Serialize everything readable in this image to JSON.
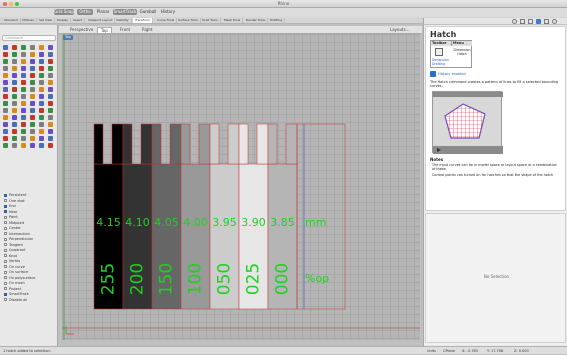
{
  "window": {
    "title": "Rhino"
  },
  "top_tabs": [
    "Grid Snap",
    "Ortho",
    "Planar",
    "SmartTrack",
    "Gumball",
    "History"
  ],
  "ribbon_tabs": [
    "Standard",
    "CPlanes",
    "Set View",
    "Display",
    "Select",
    "Viewport Layout",
    "Visibility",
    "Transform",
    "Curve Tools",
    "Surface Tools",
    "Solid Tools",
    "Mesh Tools",
    "Render Tools",
    "Drafting"
  ],
  "left_panel": {
    "search_placeholder": "Command",
    "osnaps": [
      {
        "label": "Persistent",
        "on": true
      },
      {
        "label": "One shot",
        "on": false
      },
      {
        "label": "End",
        "on": true
      },
      {
        "label": "Near",
        "on": true
      },
      {
        "label": "Point",
        "on": false
      },
      {
        "label": "Midpoint",
        "on": false
      },
      {
        "label": "Center",
        "on": false
      },
      {
        "label": "Intersection",
        "on": false
      },
      {
        "label": "Perpendicular",
        "on": false
      },
      {
        "label": "Tangent",
        "on": false
      },
      {
        "label": "Quadrant",
        "on": false
      },
      {
        "label": "Knot",
        "on": false
      },
      {
        "label": "Vertex",
        "on": false
      },
      {
        "label": "On curve",
        "on": false
      },
      {
        "label": "On surface",
        "on": false
      },
      {
        "label": "On polysurface",
        "on": false
      },
      {
        "label": "On mesh",
        "on": false
      },
      {
        "label": "Project",
        "on": false
      },
      {
        "label": "SmartTrack",
        "on": true
      },
      {
        "label": "Disable all",
        "on": false
      }
    ]
  },
  "viewport": {
    "tabs": [
      "Perspective",
      "Top",
      "Front",
      "Right"
    ],
    "active_tab": "Top",
    "label": "Top",
    "layouts_label": "Layouts...",
    "swatches": [
      {
        "fill": "#000000",
        "thickness": "4.15",
        "value": "255"
      },
      {
        "fill": "#333333",
        "thickness": "4.10",
        "value": "200"
      },
      {
        "fill": "#666666",
        "thickness": "4.05",
        "value": "150"
      },
      {
        "fill": "#999999",
        "thickness": "4.00",
        "value": "100"
      },
      {
        "fill": "#cccccc",
        "thickness": "3.95",
        "value": "050"
      },
      {
        "fill": "#e6e6e6",
        "thickness": "3.90",
        "value": "025"
      },
      {
        "fill": "#b5b5b5",
        "thickness": "3.85",
        "value": "000"
      }
    ],
    "unit_thickness": "mm",
    "unit_value": "%op",
    "label_color": "#1fd11f"
  },
  "right_panel": {
    "title": "Hatch",
    "table_headers": [
      "Toolbar",
      "Menu"
    ],
    "toolbar_link": "Dimension Drafting",
    "menu_path": "Dimension Hatch",
    "history_label": "History enabled",
    "description": "The Hatch command creates a pattern of lines to fill a selected bounding curves.",
    "notes_title": "Notes",
    "notes": [
      "The input curves can be in model space or layout space or a combination of these.",
      "Control points can turned on for hatches so that the shape of the hatch"
    ],
    "no_selection": "No Selection"
  },
  "status": {
    "command_line": "1 hatch added to selection.",
    "units": "Units",
    "cplane": "CPlane",
    "x": "X: -5.783",
    "y": "Y: 17.708",
    "z": "Z: 0.000"
  }
}
